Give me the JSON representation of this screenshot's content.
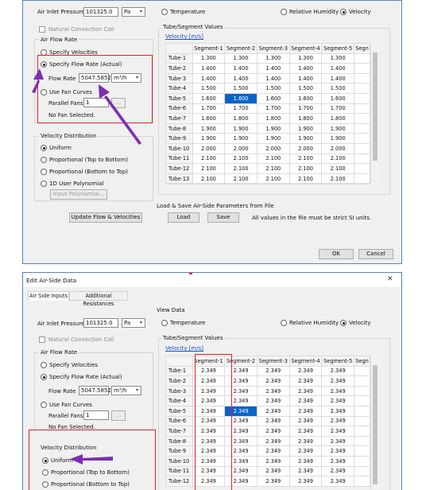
{
  "panel1": {
    "air_inlet_pressure_label": "Air Inlet Pressure",
    "air_inlet_pressure_value": "101325.0",
    "air_inlet_pressure_unit": "Pa",
    "natural_convection_label": "Natural Convection Coil",
    "air_flow_rate_group": "Air Flow Rate",
    "specify_velocities_label": "Specify Velocities",
    "specify_flow_rate_label": "Specify Flow Rate (Actual)",
    "flow_rate_label": "Flow Rate",
    "flow_rate_value": "5047.5852",
    "flow_rate_unit": "m³/h",
    "use_fan_curves_label": "Use Fan Curves",
    "parallel_fans_label": "Parallel Fans",
    "parallel_fans_value": "1",
    "ellipsis": "...",
    "no_fan_selected": "No Fan Selected.",
    "velocity_distribution_group": "Velocity Distribution",
    "uniform_label": "Uniform",
    "prop_top_bottom_label": "Proportional (Top to Bottom)",
    "prop_bottom_top_label": "Proportional (Bottom to Top)",
    "user_poly_label": "1D User Polynomial",
    "input_poly_button": "Input Polynomial...",
    "update_button": "Update Flow & Velocities",
    "view_temperature": "Temperature",
    "view_relhum": "Relative Humidity",
    "view_velocity": "Velocity",
    "tube_segment_group": "Tube/Segment Values",
    "velocity_link": "Velocity [m/s]",
    "columns": [
      "",
      "Segment-1",
      "Segment-2",
      "Segment-3",
      "Segment-4",
      "Segment-5",
      "Segn"
    ],
    "rows": [
      {
        "name": "Tube-1",
        "vals": [
          "1.300",
          "1.300",
          "1.300",
          "1.300",
          "1.300"
        ]
      },
      {
        "name": "Tube-2",
        "vals": [
          "1.400",
          "1.400",
          "1.400",
          "1.400",
          "1.400"
        ]
      },
      {
        "name": "Tube-3",
        "vals": [
          "1.400",
          "1.400",
          "1.400",
          "1.400",
          "1.400"
        ]
      },
      {
        "name": "Tube-4",
        "vals": [
          "1.500",
          "1.500",
          "1.500",
          "1.500",
          "1.500"
        ]
      },
      {
        "name": "Tube-5",
        "vals": [
          "1.600",
          "1.600",
          "1.600",
          "1.600",
          "1.600"
        ]
      },
      {
        "name": "Tube-6",
        "vals": [
          "1.700",
          "1.700",
          "1.700",
          "1.700",
          "1.700"
        ]
      },
      {
        "name": "Tube-7",
        "vals": [
          "1.800",
          "1.800",
          "1.800",
          "1.800",
          "1.800"
        ]
      },
      {
        "name": "Tube-8",
        "vals": [
          "1.900",
          "1.900",
          "1.900",
          "1.900",
          "1.900"
        ]
      },
      {
        "name": "Tube-9",
        "vals": [
          "1.900",
          "1.900",
          "1.900",
          "1.900",
          "1.900"
        ]
      },
      {
        "name": "Tube-10",
        "vals": [
          "2.000",
          "2.000",
          "2.000",
          "2.000",
          "2.000"
        ]
      },
      {
        "name": "Tube-11",
        "vals": [
          "2.100",
          "2.100",
          "2.100",
          "2.100",
          "2.100"
        ]
      },
      {
        "name": "Tube-12",
        "vals": [
          "2.100",
          "2.100",
          "2.100",
          "2.100",
          "2.100"
        ]
      },
      {
        "name": "Tube-13",
        "vals": [
          "2.100",
          "2.100",
          "2.100",
          "2.100",
          "2.100"
        ]
      }
    ],
    "load_save_group": "Load & Save Air-Side Parameters from File",
    "load_button": "Load",
    "save_button": "Save",
    "si_note": "All values in the file must be strict SI units.",
    "ok_button": "OK",
    "cancel_button": "Cancel"
  },
  "panel2": {
    "title": "Edit Air-Side Data",
    "close_glyph": "✕",
    "tab_air_side": "Air Side Inputs",
    "tab_additional": "Additional Resistances",
    "view_data_group": "View Data",
    "air_inlet_pressure_label": "Air Inlet Pressure",
    "air_inlet_pressure_value": "101325.0",
    "air_inlet_pressure_unit": "Pa",
    "natural_convection_label": "Natural Convection Coil",
    "air_flow_rate_group": "Air Flow Rate",
    "specify_velocities_label": "Specify Velocities",
    "specify_flow_rate_label": "Specify Flow Rate (Actual)",
    "flow_rate_label": "Flow Rate",
    "flow_rate_value": "5047.5852",
    "flow_rate_unit": "m³/h",
    "use_fan_curves_label": "Use Fan Curves",
    "parallel_fans_label": "Parallel Fans",
    "parallel_fans_value": "1",
    "ellipsis": "...",
    "no_fan_selected": "No Fan Selected.",
    "velocity_distribution_group": "Velocity Distribution",
    "uniform_label": "Uniform",
    "prop_top_bottom_label": "Proportional (Top to Bottom)",
    "prop_bottom_top_label": "Proportional (Bottom to Top)",
    "view_temperature": "Temperature",
    "view_relhum": "Relative Humidity",
    "view_velocity": "Velocity",
    "tube_segment_group": "Tube/Segment Values",
    "velocity_link": "Velocity [m/s]",
    "columns": [
      "",
      "Segment-1",
      "Segment-2",
      "Segment-3",
      "Segment-4",
      "Segment-5",
      "Segn"
    ],
    "rows": [
      {
        "name": "Tube-1",
        "vals": [
          "2.349",
          "2.349",
          "2.349",
          "2.349",
          "2.349"
        ]
      },
      {
        "name": "Tube-2",
        "vals": [
          "2.349",
          "2.349",
          "2.349",
          "2.349",
          "2.349"
        ]
      },
      {
        "name": "Tube-3",
        "vals": [
          "2.349",
          "2.349",
          "2.349",
          "2.349",
          "2.349"
        ]
      },
      {
        "name": "Tube-4",
        "vals": [
          "2.349",
          "2.349",
          "2.349",
          "2.349",
          "2.349"
        ]
      },
      {
        "name": "Tube-5",
        "vals": [
          "2.349",
          "2.349",
          "2.349",
          "2.349",
          "2.349"
        ]
      },
      {
        "name": "Tube-6",
        "vals": [
          "2.349",
          "2.349",
          "2.349",
          "2.349",
          "2.349"
        ]
      },
      {
        "name": "Tube-7",
        "vals": [
          "2.349",
          "2.349",
          "2.349",
          "2.349",
          "2.349"
        ]
      },
      {
        "name": "Tube-8",
        "vals": [
          "2.349",
          "2.349",
          "2.349",
          "2.349",
          "2.349"
        ]
      },
      {
        "name": "Tube-9",
        "vals": [
          "2.349",
          "2.349",
          "2.349",
          "2.349",
          "2.349"
        ]
      },
      {
        "name": "Tube-10",
        "vals": [
          "2.349",
          "2.349",
          "2.349",
          "2.349",
          "2.349"
        ]
      },
      {
        "name": "Tube-11",
        "vals": [
          "2.349",
          "2.349",
          "2.349",
          "2.349",
          "2.349"
        ]
      },
      {
        "name": "Tube-12",
        "vals": [
          "2.349",
          "2.349",
          "2.349",
          "2.349",
          "2.349"
        ]
      }
    ]
  },
  "colors": {
    "annotation_red": "#e0202a",
    "annotation_arrow": "#7b2fb0",
    "selected_cell": "#0b63c9",
    "window_border": "#5a82c2"
  }
}
